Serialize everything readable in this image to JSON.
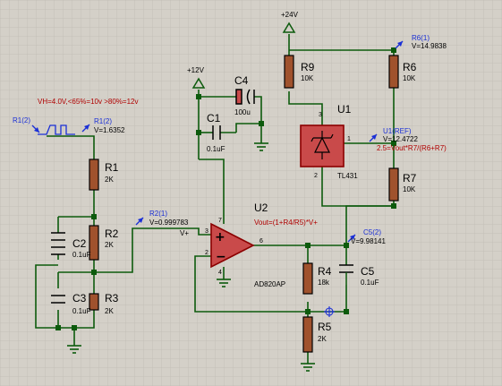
{
  "annotations": {
    "vh_note": "VH=4.0V,<65%=10v  >80%=12v",
    "u2_formula": "Vout=(1+R4/R5)*V+",
    "u1_formula": "2.5=Vout*R7/(R6+R7)"
  },
  "power": {
    "p24": "+24V",
    "p12": "+12V"
  },
  "components": {
    "r1": {
      "name": "R1",
      "value": "2K"
    },
    "r2": {
      "name": "R2",
      "value": "2K"
    },
    "r3": {
      "name": "R3",
      "value": "2K"
    },
    "r4": {
      "name": "R4",
      "value": "18k"
    },
    "r5": {
      "name": "R5",
      "value": "2K"
    },
    "r6": {
      "name": "R6",
      "value": "10K"
    },
    "r7": {
      "name": "R7",
      "value": "10K"
    },
    "r9": {
      "name": "R9",
      "value": "10K"
    },
    "c1": {
      "name": "C1",
      "value": "0.1uF"
    },
    "c2": {
      "name": "C2",
      "value": "0.1uF"
    },
    "c3": {
      "name": "C3",
      "value": "0.1uF"
    },
    "c4": {
      "name": "C4",
      "value": "100u"
    },
    "c5": {
      "name": "C5",
      "value": "0.1uF"
    },
    "u1": {
      "name": "U1",
      "part": "TL431"
    },
    "u2": {
      "name": "U2",
      "part": "AD820AP"
    }
  },
  "probes": {
    "r1_2_left": {
      "name": "R1(2)"
    },
    "r1_2": {
      "name": "R1(2)",
      "value": "V=1.6352"
    },
    "r2_1": {
      "name": "R2(1)",
      "value": "V=0.999783"
    },
    "c5_2": {
      "name": "C5(2)",
      "value": "V=9.98141"
    },
    "r6_1": {
      "name": "R6(1)",
      "value": "V=14.9838"
    },
    "u1_ref": {
      "name": "U1(REF)",
      "value": "V=12.4722"
    }
  },
  "pins": {
    "u2_in_plus": "3",
    "u2_in_minus": "2",
    "u2_out": "6",
    "u2_vcc": "7",
    "u2_gnd": "4",
    "u1_cathode": "3",
    "u1_ref": "1",
    "u1_anode": "2",
    "v_plus": "V+"
  }
}
